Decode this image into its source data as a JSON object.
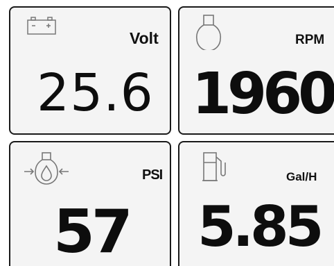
{
  "colors": {
    "tile_background": "#f4f4f4",
    "tile_border": "#1a1a1a",
    "icon": "#777777",
    "text": "#111111"
  },
  "tiles": [
    {
      "id": "volt",
      "icon": "battery-icon",
      "label": "Volt",
      "value": "25.6"
    },
    {
      "id": "rpm",
      "icon": "engine-icon",
      "label": "RPM",
      "value": "1960"
    },
    {
      "id": "psi",
      "icon": "oil-pressure-icon",
      "label": "PSI",
      "value": "57"
    },
    {
      "id": "gal",
      "icon": "fuel-pump-icon",
      "label": "Gal/H",
      "value": "5.85"
    }
  ]
}
